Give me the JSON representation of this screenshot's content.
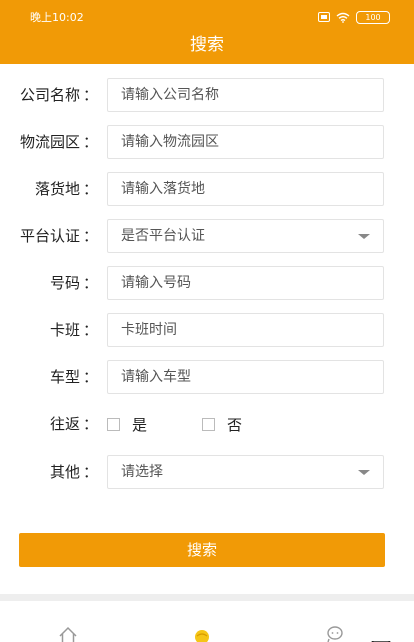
{
  "status_bar": {
    "time": "晚上10:02",
    "battery": "100",
    "icons": [
      "sim-icon",
      "wifi-icon",
      "battery-icon"
    ]
  },
  "header": {
    "title": "搜索"
  },
  "form": {
    "company_name": {
      "label": "公司名称",
      "placeholder": "请输入公司名称"
    },
    "logistics_park": {
      "label": "物流园区",
      "placeholder": "请输入物流园区"
    },
    "unloading_place": {
      "label": "落货地",
      "placeholder": "请输入落货地"
    },
    "platform_cert": {
      "label": "平台认证",
      "value": "是否平台认证"
    },
    "phone_number": {
      "label": "号码",
      "placeholder": "请输入号码"
    },
    "schedule": {
      "label": "卡班",
      "placeholder": "卡班时间"
    },
    "vehicle_type": {
      "label": "车型",
      "placeholder": "请输入车型"
    },
    "round_trip": {
      "label": "往返",
      "option_yes": "是",
      "option_no": "否"
    },
    "other": {
      "label": "其他",
      "value": "请选择"
    },
    "colon": "："
  },
  "actions": {
    "search_label": "搜索"
  },
  "tab_bar": {
    "icons": [
      "home-icon",
      "profile-icon",
      "message-icon",
      "more-icon"
    ]
  },
  "colors": {
    "accent": "#f19a06",
    "field_border": "#e3e3e3",
    "divider": "#eeeeee"
  }
}
